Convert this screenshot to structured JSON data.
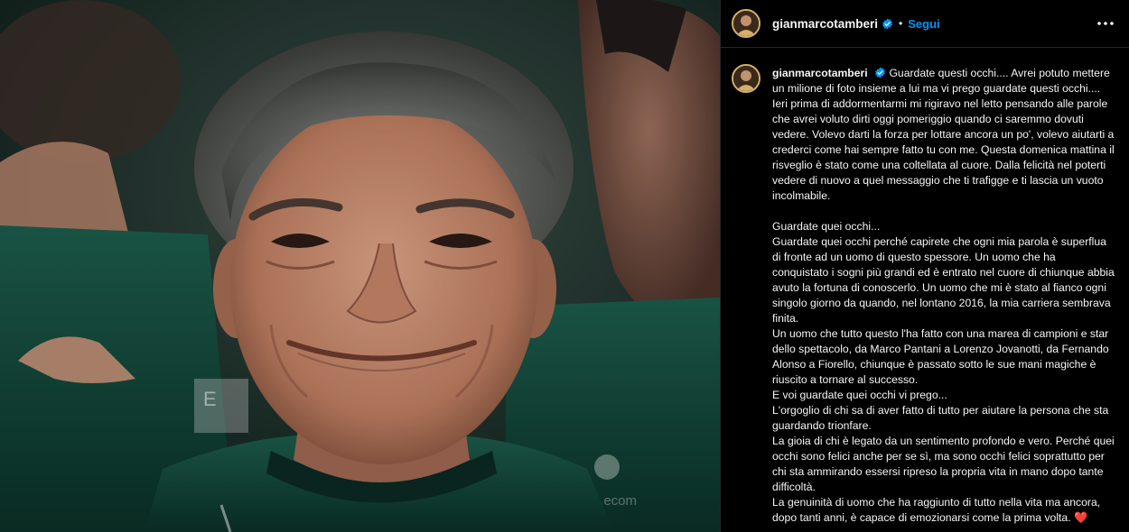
{
  "header": {
    "username": "gianmarcotamberi",
    "dot": "•",
    "follow_label": "Segui"
  },
  "caption": {
    "username": "gianmarcotamberi",
    "paragraphs": [
      "Guardate questi occhi.... Avrei potuto mettere un milione di foto insieme a lui ma vi prego guardate questi occhi.... Ieri prima di addormentarmi mi rigiravo nel letto pensando alle parole che avrei voluto dirti oggi pomeriggio quando ci saremmo dovuti vedere. Volevo darti la forza per lottare ancora un po', volevo aiutarti a crederci come hai sempre fatto tu con me. Questa domenica mattina il risveglio è stato come una coltellata al cuore. Dalla felicità nel poterti vedere di nuovo a quel messaggio che ti trafigge e ti lascia un vuoto incolmabile.",
      "Guardate quei occhi...",
      "Guardate quei occhi perché capirete che ogni mia parola è superflua di fronte ad un uomo di questo spessore. Un uomo che ha conquistato i sogni più grandi ed è entrato nel cuore di chiunque abbia avuto la fortuna di conoscerlo. Un uomo che mi è stato al fianco ogni singolo giorno da quando, nel lontano 2016, la mia carriera sembrava finita.",
      "Un uomo che tutto questo l'ha fatto con una marea di campioni e star dello spettacolo, da Marco Pantani a Lorenzo Jovanotti, da Fernando Alonso a Fiorello, chiunque è passato sotto le sue mani magiche è riuscito a tornare al successo.",
      "E voi guardate quei occhi vi prego...",
      "L'orgoglio di chi sa di aver fatto di tutto per aiutare la persona che sta guardando trionfare.",
      "La gioia di chi è legato da un sentimento profondo e vero. Perché quei occhi sono felici anche per se sì, ma sono occhi felici soprattutto per chi sta ammirando essersi ripreso la propria vita in mano dopo tante difficoltà.",
      "La genuinità di uomo che ha raggiunto di tutto nella vita ma ancora, dopo tanti anni, è capace di emozionarsi come la prima volta."
    ],
    "end_emoji": "❤️"
  },
  "colors": {
    "background": "#000000",
    "follow_blue": "#0095f6",
    "verified_blue": "#0095f6",
    "heart_red": "#ff3040",
    "photo_jersey_green": "#124a3c"
  },
  "icons": {
    "verified": "verified-badge-icon",
    "more": "more-options-icon"
  }
}
